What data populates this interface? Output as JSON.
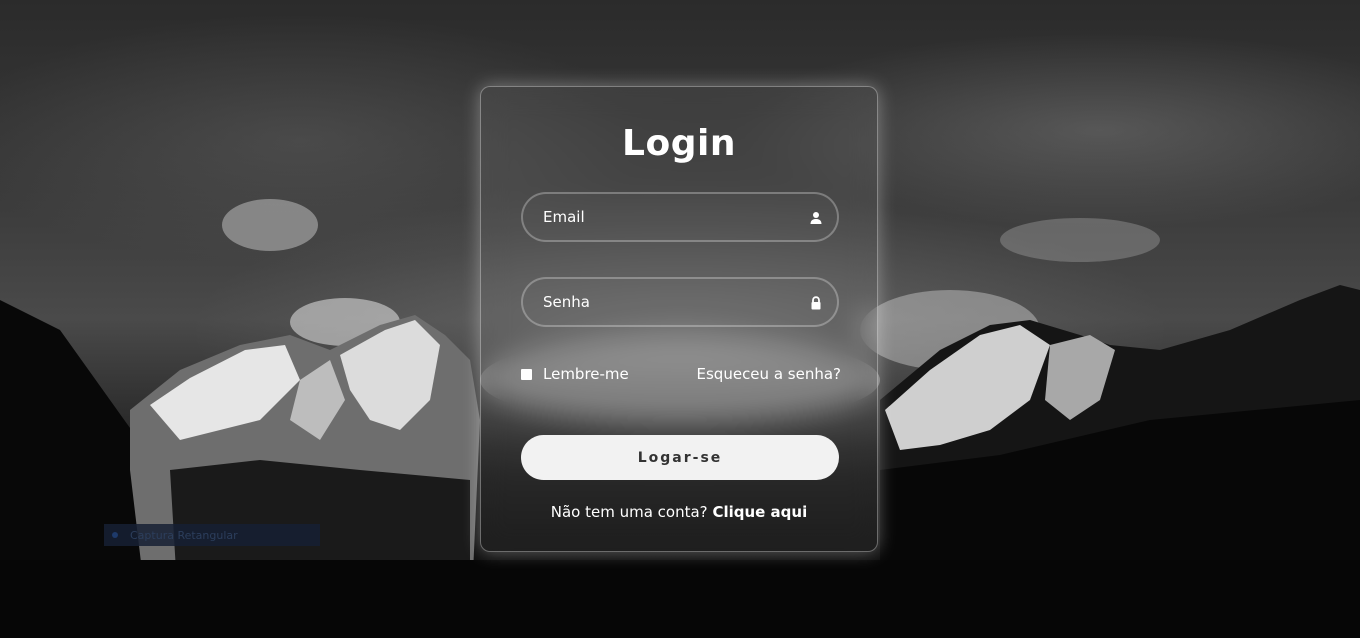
{
  "login": {
    "title": "Login",
    "email_placeholder": "Email",
    "password_placeholder": "Senha",
    "remember_label": "Lembre-me",
    "forgot_label": "Esqueceu a senha?",
    "submit_label": "Logar-se",
    "register_prompt": "Não tem uma conta?",
    "register_link": "Clique aqui"
  },
  "icons": {
    "email": "user-icon",
    "password": "lock-icon"
  },
  "overlay": {
    "capture_label": "Captura Retangular"
  },
  "colors": {
    "text": "#ffffff",
    "button_bg": "#f2f2f2",
    "button_text": "#333333"
  }
}
